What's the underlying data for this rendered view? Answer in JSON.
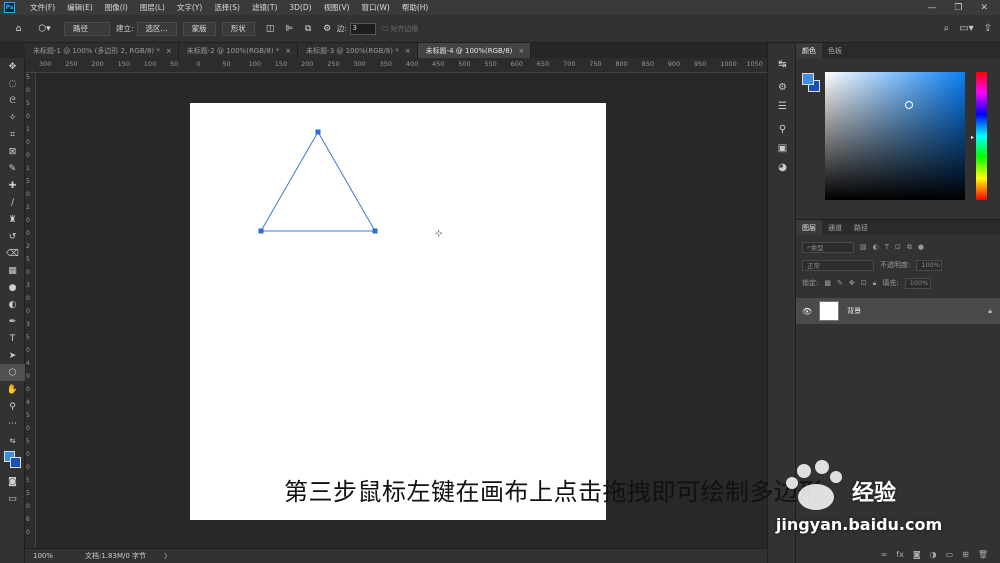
{
  "menubar": {
    "logo": "Ps",
    "items": [
      "文件(F)",
      "编辑(E)",
      "图像(I)",
      "图层(L)",
      "文字(Y)",
      "选择(S)",
      "滤镜(T)",
      "3D(D)",
      "视图(V)",
      "窗口(W)",
      "帮助(H)"
    ],
    "controls": [
      "—",
      "❐",
      "✕"
    ]
  },
  "options": {
    "mode": "路径",
    "make_label": "建立:",
    "selection_btn": "选区...",
    "mask_btn": "蒙版",
    "shape_btn": "形状",
    "sides_label": "边:",
    "sides_value": "3",
    "align_edges": "对齐边缘"
  },
  "tabs": [
    {
      "label": "未标题-1 @ 100% (多边形 2, RGB/8) *"
    },
    {
      "label": "未标题-2 @ 100%(RGB/8) *"
    },
    {
      "label": "未标题-3 @ 100%(RGB/8) *"
    },
    {
      "label": "未标题-4 @ 100%(RGB/8)"
    }
  ],
  "ruler": {
    "top": [
      "300",
      "250",
      "200",
      "150",
      "100",
      "50",
      "0",
      "50",
      "100",
      "150",
      "200",
      "250",
      "300",
      "350",
      "400",
      "450",
      "500",
      "550",
      "600",
      "650",
      "700",
      "750",
      "800",
      "850",
      "900",
      "950",
      "1000",
      "1050"
    ],
    "left": [
      "5",
      "0",
      "5",
      "0",
      "1",
      "0",
      "0",
      "1",
      "5",
      "0",
      "2",
      "0",
      "0",
      "2",
      "5",
      "0",
      "3",
      "0",
      "0",
      "3",
      "5",
      "0",
      "4",
      "0",
      "0",
      "4",
      "5",
      "0",
      "5",
      "0",
      "0",
      "5",
      "5",
      "0",
      "6",
      "0"
    ]
  },
  "status": {
    "zoom": "100%",
    "doc": "文档:1.83M/0 字节",
    "arrow": "〉"
  },
  "color_panel": {
    "tabs": [
      "颜色",
      "色板"
    ],
    "foreground": "#3b8ee0",
    "background": "#1b4fb8"
  },
  "layers_panel": {
    "tabs": [
      "图层",
      "通道",
      "路径"
    ],
    "kind": "类型",
    "blend": "正常",
    "opacity_label": "不透明度:",
    "opacity_value": "100%",
    "lock_label": "锁定:",
    "fill_label": "填充:",
    "fill_value": "100%",
    "layer_name": "背景"
  },
  "triangle": {
    "stroke": "#3a7cc8"
  },
  "caption": "第三步鼠标左键在画布上点击拖拽即可绘制多边形",
  "watermark": {
    "text": "jingyan.baidu.com",
    "cn": "经验"
  }
}
